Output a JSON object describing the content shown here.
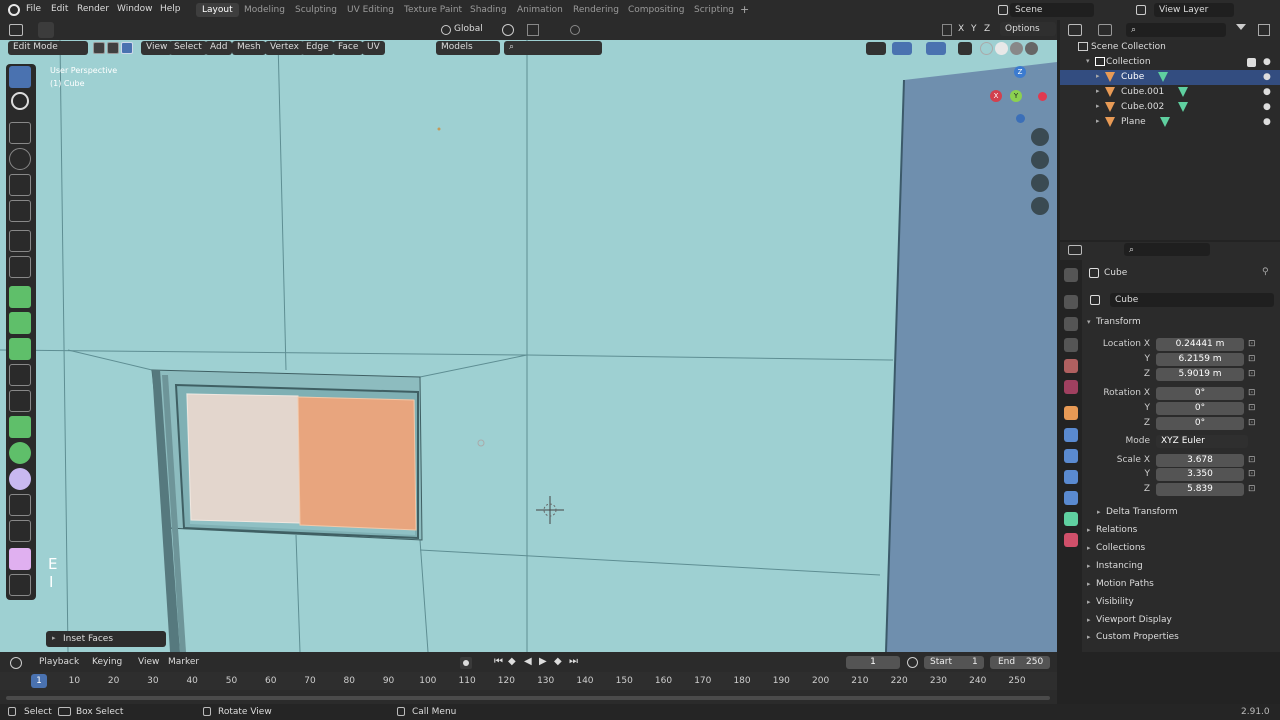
{
  "topbar": {
    "menus": [
      "File",
      "Edit",
      "Render",
      "Window",
      "Help"
    ],
    "workspaces": [
      "Layout",
      "Modeling",
      "Sculpting",
      "UV Editing",
      "Texture Paint",
      "Shading",
      "Animation",
      "Rendering",
      "Compositing",
      "Scripting"
    ],
    "active_workspace": "Layout",
    "add_tab": "+",
    "scene": "Scene",
    "view_layer": "View Layer"
  },
  "viewport_header": {
    "mode": "Edit Mode",
    "menus": [
      "View",
      "Select",
      "Add",
      "Mesh",
      "Vertex",
      "Edge",
      "Face",
      "UV"
    ],
    "orientation": "Global",
    "models": "Models",
    "options": "Options",
    "axes": [
      "X",
      "Y",
      "Z"
    ]
  },
  "viewport": {
    "perspective": "User Perspective",
    "object": "(1) Cube",
    "operator_panel": "Inset Faces",
    "key_hint_1": "E",
    "key_hint_2": "I",
    "gizmo": {
      "x": "X",
      "y": "Y",
      "z": "Z"
    },
    "bg_color": "#9ed0d2"
  },
  "outliner": {
    "scene_collection": "Scene Collection",
    "collection": "Collection",
    "items": [
      "Cube",
      "Cube.001",
      "Cube.002",
      "Plane"
    ],
    "selected": "Cube"
  },
  "properties": {
    "object_name": "Cube",
    "data_name": "Cube",
    "transform_label": "Transform",
    "location_label": "Location X",
    "location": [
      "0.24441 m",
      "6.2159 m",
      "5.9019 m"
    ],
    "rotation_label": "Rotation X",
    "rotation": [
      "0°",
      "0°",
      "0°"
    ],
    "mode_label": "Mode",
    "mode": "XYZ Euler",
    "scale_label": "Scale X",
    "scale": [
      "3.678",
      "3.350",
      "5.839"
    ],
    "y_label": "Y",
    "z_label": "Z",
    "sections": [
      "Delta Transform",
      "Relations",
      "Collections",
      "Instancing",
      "Motion Paths",
      "Visibility",
      "Viewport Display",
      "Custom Properties"
    ]
  },
  "timeline": {
    "menus": [
      "Playback",
      "Keying",
      "View",
      "Marker"
    ],
    "current_frame": "1",
    "start_label": "Start",
    "start": "1",
    "end_label": "End",
    "end": "250",
    "ticks": [
      "1",
      "10",
      "20",
      "30",
      "40",
      "50",
      "60",
      "70",
      "80",
      "90",
      "100",
      "110",
      "120",
      "130",
      "140",
      "150",
      "160",
      "170",
      "180",
      "190",
      "200",
      "210",
      "220",
      "230",
      "240",
      "250"
    ]
  },
  "statusbar": {
    "select": "Select",
    "box_select": "Box Select",
    "rotate_view": "Rotate View",
    "call_menu": "Call Menu",
    "version": "2.91.0"
  },
  "colors": {
    "accent": "#4a72b0",
    "selected_face": "#e8a57e",
    "selected_face_light": "#e3d6cd"
  }
}
